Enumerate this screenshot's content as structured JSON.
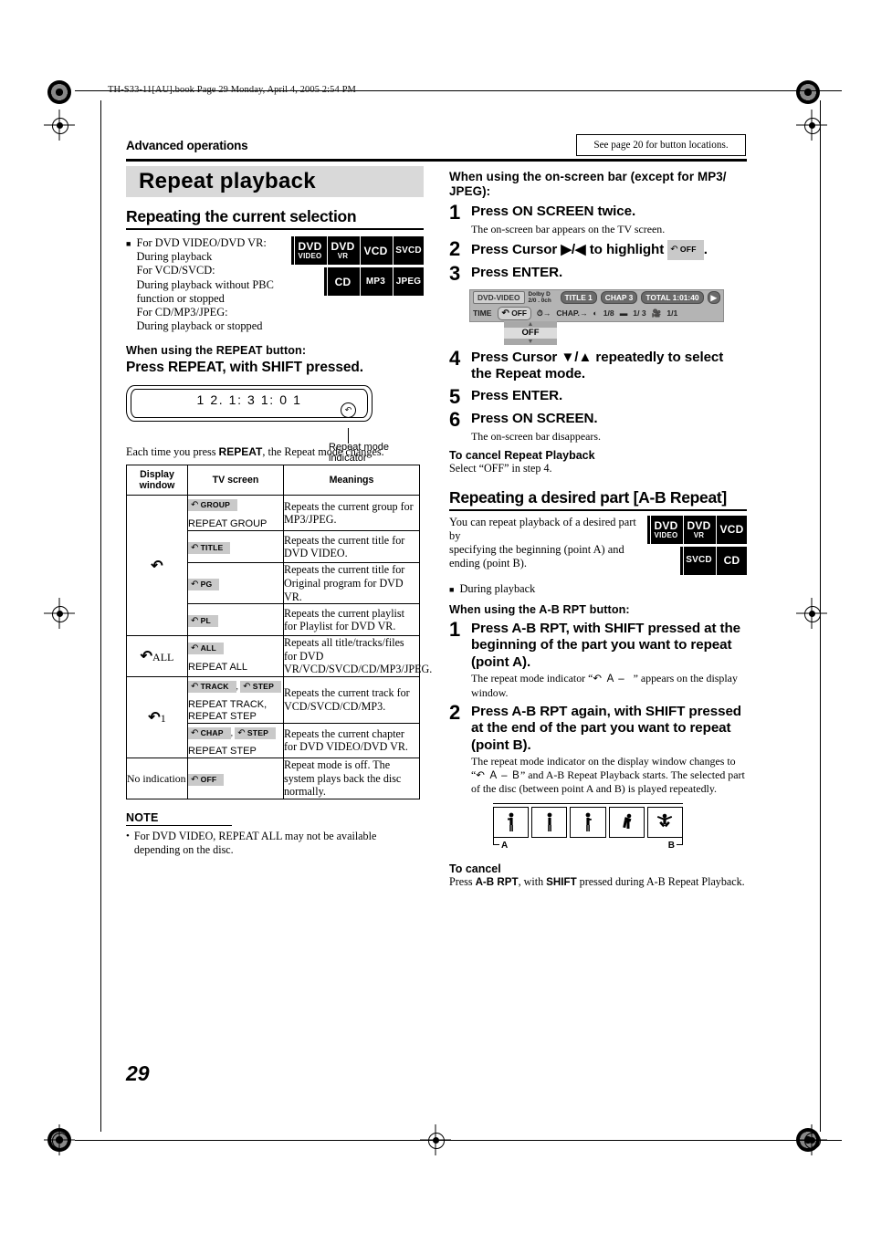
{
  "file_header": "TH-S33-11[AU].book  Page 29  Monday, April 4, 2005  2:54 PM",
  "page_number": "29",
  "running_head": "Advanced operations",
  "see_page_note": "See page 20 for button locations.",
  "section_title": "Repeat playback",
  "left": {
    "sub_title": "Repeating the current selection",
    "condition_text": "For DVD VIDEO/DVD VR:\nDuring playback\nFor VCD/SVCD:\nDuring playback without PBC function or stopped\nFor CD/MP3/JPEG:\nDuring playback or stopped",
    "condition_lines": [
      "For DVD VIDEO/DVD VR:",
      "During playback",
      "For VCD/SVCD:",
      "During playback without PBC",
      "function or stopped",
      "For CD/MP3/JPEG:",
      "During playback or stopped"
    ],
    "disc_badges_row1": [
      {
        "t1": "DVD",
        "t2": "VIDEO"
      },
      {
        "t1": "DVD",
        "t2": "VR"
      },
      {
        "only": "VCD"
      },
      {
        "only": "SVCD",
        "small": true
      }
    ],
    "disc_badges_row2": [
      {
        "only": "CD"
      },
      {
        "only": "MP3",
        "small": true
      },
      {
        "only": "JPEG",
        "small": true
      }
    ],
    "when_using_heading": "When using the REPEAT button:",
    "press_instruction": "Press REPEAT, with SHIFT pressed.",
    "display_window_value": "1 2.     1: 3  1: 0 1",
    "repeat_indicator_caption": "Repeat mode indicator",
    "each_time_prefix": "Each time you press ",
    "each_time_bold": "REPEAT",
    "each_time_suffix": ", the Repeat mode changes.",
    "table": {
      "headers": [
        "Display\nwindow",
        "TV screen",
        "Meanings"
      ],
      "header_display_line1": "Display",
      "header_display_line2": "window",
      "header_tv": "TV screen",
      "header_meanings": "Meanings",
      "groups": [
        {
          "display_window": "",
          "display_icon": "repeat-arrow",
          "display_suffix": "",
          "rows": [
            {
              "tv_chip": "GROUP",
              "tv_plain": "REPEAT GROUP",
              "meaning": "Repeats the current group for MP3/JPEG."
            },
            {
              "tv_chip": "TITLE",
              "tv_plain": "",
              "meaning": "Repeats the current title for DVD VIDEO."
            },
            {
              "tv_chip": "PG",
              "tv_plain": "",
              "meaning": "Repeats the current title for Original program for DVD VR."
            },
            {
              "tv_chip": "PL",
              "tv_plain": "",
              "meaning": "Repeats the current playlist for Playlist for DVD VR."
            }
          ]
        },
        {
          "display_window": "ALL",
          "display_icon": "repeat-arrow",
          "rows": [
            {
              "tv_chip": "ALL",
              "tv_plain": "REPEAT ALL",
              "meaning": "Repeats all title/tracks/files for DVD VR/VCD/SVCD/CD/MP3/JPEG."
            }
          ]
        },
        {
          "display_window": "1",
          "display_icon": "repeat-arrow",
          "rows": [
            {
              "tv_chip": "TRACK",
              "tv_chip2": "STEP",
              "tv_plain": "REPEAT TRACK,\nREPEAT STEP",
              "meaning": "Repeats the current track for VCD/SVCD/CD/MP3."
            },
            {
              "tv_chip": "CHAP",
              "tv_chip2": "STEP",
              "tv_plain": "REPEAT STEP",
              "meaning": "Repeats the current chapter for DVD VIDEO/DVD VR."
            }
          ]
        },
        {
          "display_window": "No indication",
          "display_icon": "",
          "rows": [
            {
              "tv_chip": "OFF",
              "tv_plain": "",
              "meaning": "Repeat mode is off. The system plays back the disc normally."
            }
          ]
        }
      ]
    },
    "note_heading": "NOTE",
    "note_items": [
      "For DVD VIDEO, REPEAT ALL may not be available depending on the disc."
    ]
  },
  "right": {
    "onscreen_heading_line1": "When using the on-screen bar (except for MP3/",
    "onscreen_heading_line2": "JPEG):",
    "steps": [
      {
        "num": "1",
        "text": "Press ON SCREEN twice.",
        "sub": "The on-screen bar appears on the TV screen."
      },
      {
        "num": "2",
        "text_before": "Press Cursor ",
        "cursor": "▶/◀",
        "text_mid": " to highlight ",
        "chip": "OFF",
        "text_after": "."
      },
      {
        "num": "3",
        "text": "Press ENTER."
      },
      {
        "num": "4",
        "text_before": "Press Cursor ",
        "cursor": "▼/▲",
        "text_after": " repeatedly to select the Repeat mode."
      },
      {
        "num": "5",
        "text": "Press ENTER."
      },
      {
        "num": "6",
        "text": "Press ON SCREEN.",
        "sub": "The on-screen bar disappears."
      }
    ],
    "onscreen_bar": {
      "disc_label": "DVD-VIDEO",
      "audio_line1": "Dolby D",
      "audio_line2": "2/0 . 0ch",
      "title": "TITLE  1",
      "chapter": "CHAP  3",
      "total": "TOTAL   1:01:40",
      "time_label": "TIME",
      "repeat_value": "OFF",
      "time_search": "→",
      "chapter_search": "CHAP.→",
      "audio_value": "1/8",
      "subtitle_value": "1/ 3",
      "angle_value": "1/1",
      "dropdown_value": "OFF"
    },
    "cancel_repeat_heading": "To cancel Repeat Playback",
    "cancel_repeat_body": "Select “OFF” in step 4.",
    "ab_title": "Repeating a desired part [A-B Repeat]",
    "ab_intro_lines": [
      "You can repeat playback of a desired part by",
      "specifying the beginning (point A) and",
      "ending (point B)."
    ],
    "ab_bullet": "During playback",
    "ab_disc_row1": [
      {
        "t1": "DVD",
        "t2": "VIDEO"
      },
      {
        "t1": "DVD",
        "t2": "VR"
      },
      {
        "only": "VCD"
      }
    ],
    "ab_disc_row2": [
      {
        "only": "SVCD",
        "small": true
      },
      {
        "only": "CD"
      }
    ],
    "ab_when_heading": "When using the A-B RPT button:",
    "ab_steps": [
      {
        "num": "1",
        "text": "Press A-B RPT, with SHIFT pressed at the beginning of the part you want to repeat (point A).",
        "sub_before": "The repeat mode indicator “",
        "sub_ind": "A –",
        "sub_after": "” appears on the display window."
      },
      {
        "num": "2",
        "text": "Press A-B RPT again, with SHIFT pressed at the end of the part you want to repeat (point B).",
        "sub_line1": "The repeat mode indicator on the display window changes to",
        "sub_before": "“",
        "sub_ind": "A – B",
        "sub_after": "” and A-B Repeat Playback starts. The selected part of the disc (between point A and B) is played repeatedly."
      }
    ],
    "strip_label_a": "A",
    "strip_label_b": "B",
    "to_cancel_heading": "To cancel",
    "to_cancel_body_1": "Press ",
    "to_cancel_bold_1": "A-B RPT",
    "to_cancel_body_2": ", with ",
    "to_cancel_bold_2": "SHIFT",
    "to_cancel_body_3": " pressed during A-B Repeat Playback."
  },
  "colors": {
    "bar_gray": "#d9d9d9",
    "chip_gray": "#c9c9c9",
    "osd_gray": "#b4b4b4"
  }
}
